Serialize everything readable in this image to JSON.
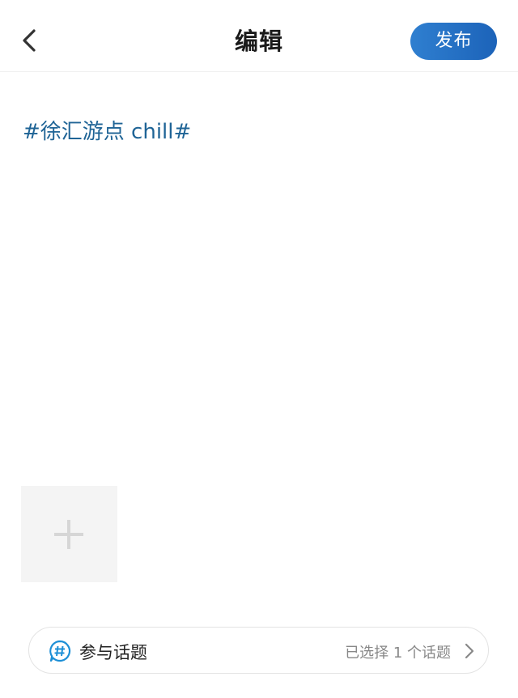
{
  "header": {
    "title": "编辑",
    "publish_label": "发布",
    "back_icon": "chevron-left-icon",
    "publish_gradient": [
      "#2f7fd0",
      "#1c63b9"
    ]
  },
  "editor": {
    "topic_text": "#徐汇游点 chill#",
    "topic_color": "#1f6496",
    "add_image_icon": "plus-icon"
  },
  "topic_bar": {
    "label": "参与话题",
    "status": "已选择 1 个话题",
    "icon": "hashtag-bubble-icon",
    "icon_color": "#1d8fd6",
    "chevron_icon": "chevron-right-icon"
  }
}
